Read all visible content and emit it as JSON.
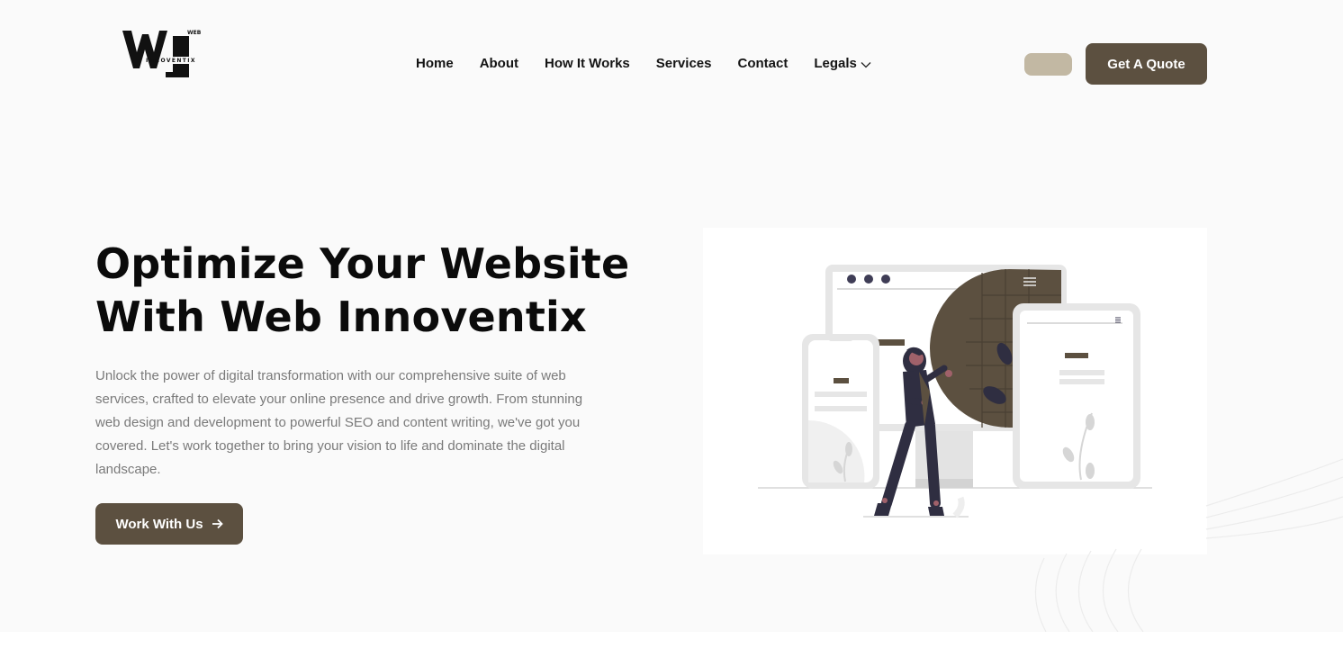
{
  "brand": {
    "logo_top": "WEB",
    "logo_bottom": "INNOVENTIX",
    "accent": "#5c5040",
    "accent_light": "#c2b8a3"
  },
  "nav": {
    "items": [
      {
        "label": "Home"
      },
      {
        "label": "About"
      },
      {
        "label": "How It Works"
      },
      {
        "label": "Services"
      },
      {
        "label": "Contact"
      },
      {
        "label": "Legals",
        "icon": "chevron-down-icon"
      }
    ]
  },
  "header": {
    "quote_label": "Get A Quote"
  },
  "hero": {
    "headline_line1": "Optimize Your Website",
    "headline_line2": "With Web Innoventix",
    "description": "Unlock the power of digital transformation with our comprehensive suite of web services, crafted to elevate your online presence and drive growth. From stunning web design and development to powerful SEO and content writing, we've got you covered. Let's work together to bring your vision to life and dominate the digital landscape.",
    "cta_label": "Work With Us",
    "cta_icon": "arrow-right-icon"
  }
}
